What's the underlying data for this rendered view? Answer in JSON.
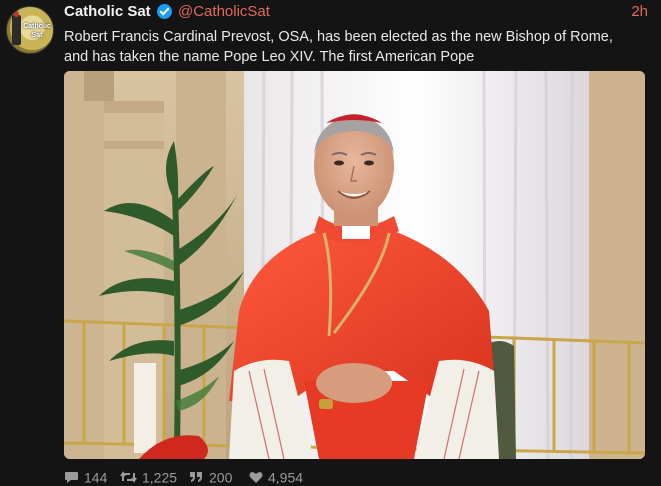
{
  "author": {
    "name": "Catholic Sat",
    "handle": "@CatholicSat",
    "time": "2h",
    "avatar_text": "Catholic Sat",
    "verified_icon": "verified-badge-icon"
  },
  "tweet": {
    "line1": "Robert Francis Cardinal Prevost, OSA, has been elected as the new Bishop of Rome,",
    "line2": "and has taken the name Pope Leo XIV. The first American Pope"
  },
  "stats": {
    "replies": "144",
    "retweets": "1,225",
    "quotes": "200",
    "likes": "4,954"
  },
  "colors": {
    "background": "#141414",
    "accent": "#e06a5b",
    "verified": "#1d9bf0",
    "text": "#e9e9e9",
    "muted": "#9a9a9a"
  }
}
